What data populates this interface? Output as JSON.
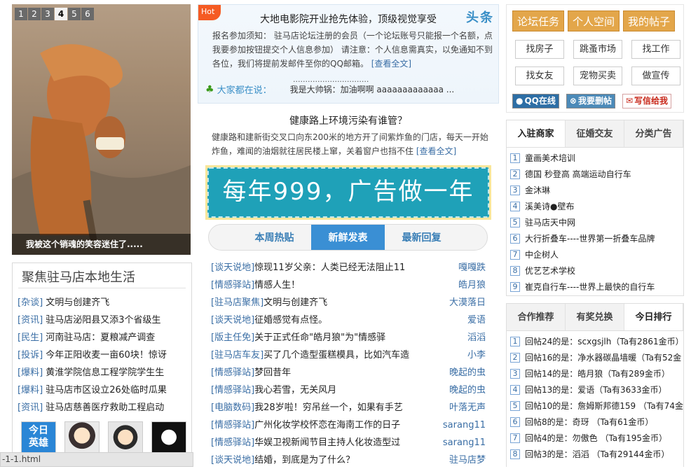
{
  "slider": {
    "numbers": [
      "1",
      "2",
      "3",
      "4",
      "5",
      "6"
    ],
    "active_index": 3,
    "caption": "我被这个销魂的笑容迷住了....."
  },
  "local": {
    "title": "聚焦驻马店本地生活",
    "items": [
      {
        "cat": "[杂谈]",
        "text": " 文明与创建齐飞"
      },
      {
        "cat": "[资讯]",
        "text": " 驻马店泌阳县又添3个省级生"
      },
      {
        "cat": "[民生]",
        "text": " 河南驻马店：夏粮减产调查"
      },
      {
        "cat": "[投诉]",
        "text": " 今年正阳收麦一亩60块！惊讶"
      },
      {
        "cat": "[爆料]",
        "text": " 黄淮学院信息工程学院学生生"
      },
      {
        "cat": "[爆料]",
        "text": " 驻马店市区设立26处临时瓜果"
      },
      {
        "cat": "[资讯]",
        "text": " 驻马店慈善医疗救助工程启动"
      }
    ],
    "avatar1_text": "今日\n英雄"
  },
  "news1": {
    "hot": "Hot",
    "slogan": "头条",
    "title": "大地电影院开业抢先体验，顶级视觉享受",
    "body": "报名参加须知： 驻马店论坛注册的会员（一个论坛账号只能报一个名额，点我要参加按钮提交个人信息参加） 请注意：个人信息需真实，以免通知不到各位，我们将提前发邮件至你的QQ邮箱。",
    "more": "[查看全文]"
  },
  "saying": {
    "label": "大家都在说：",
    "prev": "...............................",
    "message": "我是大帅锅：加油啊啊 aaaaaaaaaaaaa ..."
  },
  "news2": {
    "title": "健康路上环境污染有谁管？",
    "body": "健康路和建新街交叉口向东200米的地方开了间紫炸鱼的门店，每天一开始炸鱼，难闻的油烟就往居民楼上窜，关着窗户也挡不住",
    "more": "[查看全文]"
  },
  "ad": {
    "text": "每年999，广告做一年"
  },
  "mid_tabs": [
    "本周热贴",
    "新鲜发表",
    "最新回复"
  ],
  "mid_tab_active": 1,
  "posts": [
    {
      "cat": "[谈天说地]",
      "title": " 惊现11岁父亲：人类已经无法阻止11",
      "author": "嘎嘎跌"
    },
    {
      "cat": "[情感驿站]",
      "title": " 情感人生！",
      "author": "皓月狼"
    },
    {
      "cat": "[驻马店聚焦]",
      "title": " 文明与创建齐飞",
      "author": "大漠落日"
    },
    {
      "cat": "[谈天说地]",
      "title": " 征婚感觉有点怪。",
      "author": "爱语"
    },
    {
      "cat": "[版主任免]",
      "title": " 关于正式任命\"皓月狼\"为\"情感驿",
      "author": "滔滔"
    },
    {
      "cat": "[驻马店车友]",
      "title": " 买了几个造型蛋糕模具，比如汽车造",
      "author": "小李"
    },
    {
      "cat": "[情感驿站]",
      "title": " 梦回昔年",
      "author": "晚起的虫"
    },
    {
      "cat": "[情感驿站]",
      "title": " 我心若雪，无关风月",
      "author": "晚起的虫"
    },
    {
      "cat": "[电脑数码]",
      "title": " 我28岁啦！穷吊丝一个，如果有手艺",
      "author": "叶落无声"
    },
    {
      "cat": "[情感驿站]",
      "title": " 广州化妆学校怀恋在海南工作的日子",
      "author": "sarang11"
    },
    {
      "cat": "[情感驿站]",
      "title": " 华娱卫视新闻节目主持人化妆造型过",
      "author": "sarang11"
    },
    {
      "cat": "[谈天说地]",
      "title": " 结婚，到底是为了什么？",
      "author": "驻马店梦"
    }
  ],
  "right_top": {
    "orange": [
      "论坛任务",
      "个人空间",
      "我的帖子"
    ],
    "grey": [
      "找房子",
      "跳蚤市场",
      "找工作",
      "找女友",
      "宠物买卖",
      "做宣传"
    ],
    "small": [
      "QQ在线",
      "我要删帖",
      "写信给我"
    ]
  },
  "box1": {
    "tabs": [
      "入驻商家",
      "征婚交友",
      "分类广告"
    ],
    "active": 0,
    "items": [
      "童画美术培训",
      "德国 秒登高 高端运动自行车",
      "金沐琳",
      "溪美诗●壁布",
      "驻马店天中网",
      "大行折叠车----世界第一折叠车品牌",
      "中企树人",
      "优艺艺术学校",
      "崔克自行车----世界上最快的自行车"
    ]
  },
  "box2": {
    "tabs": [
      "合作推荐",
      "有奖兑换",
      "今日排行"
    ],
    "active": 2,
    "items": [
      "回帖24的是：scxgsjlh（Ta有2861金币）",
      "回帖16的是：净水器碳晶墙暖（Ta有52金",
      "回帖14的是：皓月狼（Ta有289金币）",
      "回帖13的是：爱语（Ta有3633金币）",
      "回帖10的是：詹姆斯邦德159 （Ta有74金",
      "回帖8的是：奇玡 （Ta有61金币）",
      "回帖4的是：勿傲色 （Ta有195金币）",
      "回帖3的是：滔滔 （Ta有29144金币）"
    ]
  },
  "status_bar": "-1-1.html"
}
